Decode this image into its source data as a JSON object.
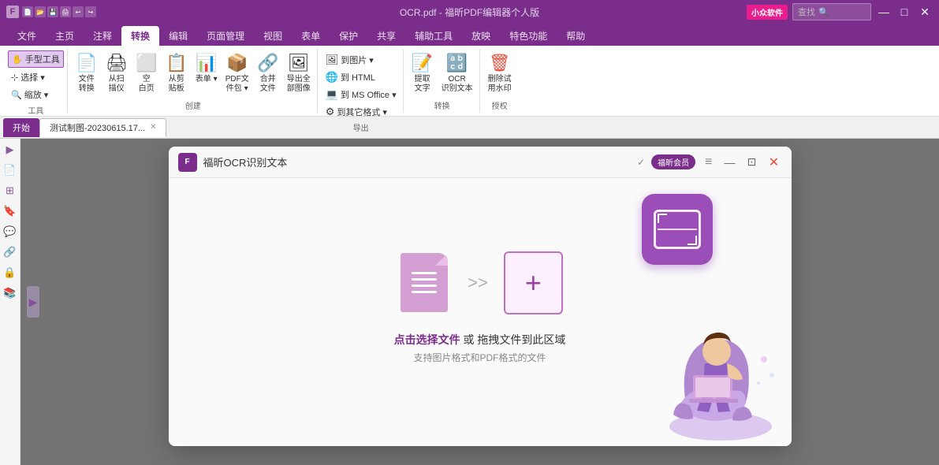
{
  "app": {
    "title": "OCR.pdf - 福昕PDF编辑器个人版",
    "xiazhuan_label": "小众软件"
  },
  "titlebar": {
    "icons": [
      "file-icon",
      "save-icon",
      "print-icon",
      "undo-icon",
      "redo-icon",
      "misc-icon"
    ]
  },
  "ribbon": {
    "tabs": [
      {
        "label": "文件",
        "active": false
      },
      {
        "label": "主页",
        "active": false
      },
      {
        "label": "注释",
        "active": false
      },
      {
        "label": "转换",
        "active": true
      },
      {
        "label": "编辑",
        "active": false
      },
      {
        "label": "页面管理",
        "active": false
      },
      {
        "label": "视图",
        "active": false
      },
      {
        "label": "表单",
        "active": false
      },
      {
        "label": "保护",
        "active": false
      },
      {
        "label": "共享",
        "active": false
      },
      {
        "label": "辅助工具",
        "active": false
      },
      {
        "label": "放映",
        "active": false
      },
      {
        "label": "特色功能",
        "active": false
      },
      {
        "label": "帮助",
        "active": false
      }
    ],
    "groups": [
      {
        "label": "工具",
        "items": [
          {
            "icon": "✋",
            "label": "手型工具"
          },
          {
            "icon": "⊹",
            "label": "选择▾"
          },
          {
            "icon": "🔍",
            "label": "缩放▾"
          }
        ]
      },
      {
        "label": "",
        "items": [
          {
            "icon": "📄",
            "label": "文件\n转换"
          },
          {
            "icon": "🖨",
            "label": "从扫\n描仪"
          },
          {
            "icon": "⬜",
            "label": "空\n白页"
          },
          {
            "icon": "✂",
            "label": "从剪\n贴板"
          },
          {
            "icon": "📊",
            "label": "表单▾"
          },
          {
            "icon": "📦",
            "label": "PDF文\n件包▾"
          },
          {
            "icon": "🔗",
            "label": "合并\n文件"
          },
          {
            "icon": "🖼",
            "label": "导出全\n部图像"
          }
        ]
      },
      {
        "label": "创建",
        "items": []
      },
      {
        "label": "导出",
        "items": [
          {
            "icon": "🖼",
            "label": "到图片▾"
          },
          {
            "icon": "🌐",
            "label": "到 HTML"
          },
          {
            "icon": "💻",
            "label": "到 MS\nOffice▾"
          },
          {
            "icon": "⚙",
            "label": "到其它格式▾"
          }
        ]
      },
      {
        "label": "转换",
        "items": [
          {
            "icon": "📝",
            "label": "提取\n文字"
          },
          {
            "icon": "🔡",
            "label": "OCR\n识别文本"
          }
        ]
      },
      {
        "label": "授权",
        "items": [
          {
            "icon": "🗑",
            "label": "删除试\n用水印"
          }
        ]
      }
    ]
  },
  "tabbar": {
    "start_label": "开始",
    "tabs": [
      {
        "label": "测试制图-20230615.17...",
        "active": true
      }
    ]
  },
  "sidebar": {
    "icons": [
      "arrow-right",
      "document",
      "layers",
      "bookmark",
      "comment",
      "link",
      "lock",
      "layers2"
    ]
  },
  "ocr_dialog": {
    "logo_text": "F",
    "title": "福昕OCR识别文本",
    "member_badge": "福昕会员",
    "upload_main_text_before": "点击选择文件 或 拖拽文件到此区域",
    "upload_sub_text": "支持图片格式和PDF格式的文件",
    "controls": {
      "minimize": "—",
      "restore": "⊡",
      "close": "✕"
    }
  }
}
